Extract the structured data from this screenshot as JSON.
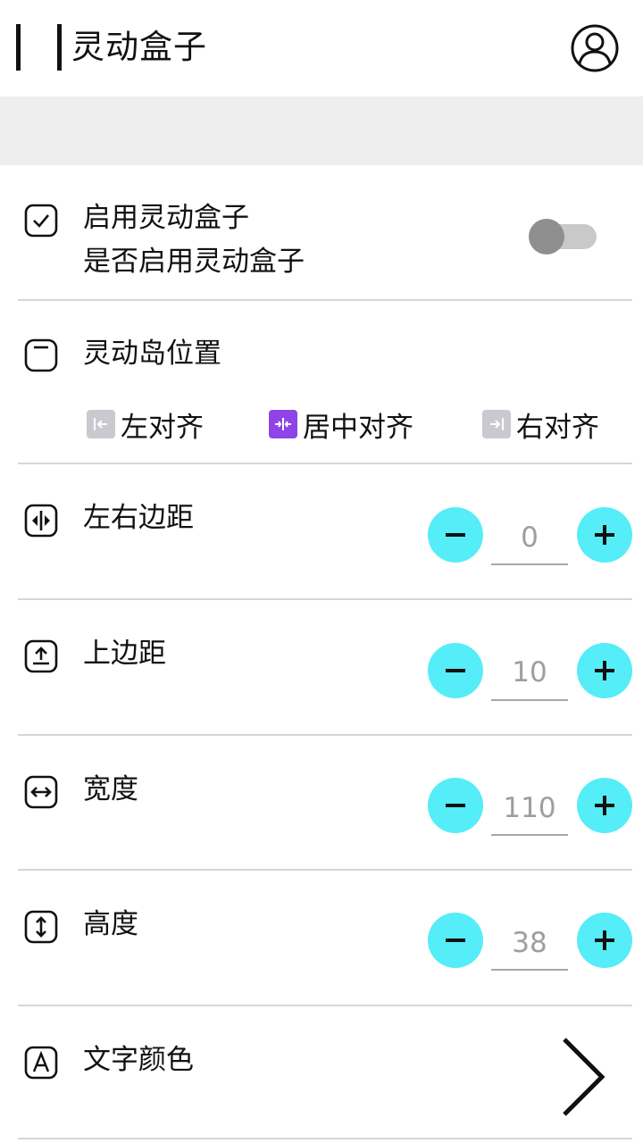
{
  "header": {
    "title": "灵动盒子",
    "user_icon": "user-circle-icon"
  },
  "settings": {
    "enable": {
      "title": "启用灵动盒子",
      "subtitle": "是否启用灵动盒子",
      "icon": "checkbox-icon",
      "enabled": false
    },
    "position": {
      "title": "灵动岛位置",
      "icon": "pill-shape-icon",
      "options": [
        {
          "label": "左对齐",
          "icon": "align-left-icon",
          "selected": false
        },
        {
          "label": "居中对齐",
          "icon": "align-center-icon",
          "selected": true
        },
        {
          "label": "右对齐",
          "icon": "align-right-icon",
          "selected": false
        }
      ]
    },
    "h_margin": {
      "title": "左右边距",
      "value": "0",
      "icon": "horizontal-margin-icon"
    },
    "top_margin": {
      "title": "上边距",
      "value": "10",
      "icon": "top-margin-icon"
    },
    "width": {
      "title": "宽度",
      "value": "110",
      "icon": "width-arrows-icon"
    },
    "height": {
      "title": "高度",
      "value": "38",
      "icon": "height-arrows-icon"
    },
    "text_color": {
      "title": "文字颜色",
      "icon": "font-a-icon"
    }
  },
  "colors": {
    "accent": "#55edf7",
    "selected": "#8e44e6",
    "unselected": "#c9c9cf"
  }
}
